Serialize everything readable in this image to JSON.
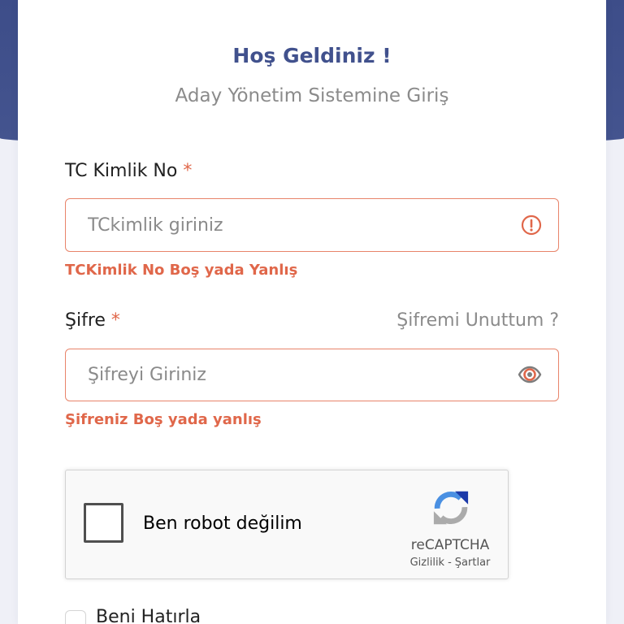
{
  "header": {
    "title": "Hoş Geldiniz !",
    "subtitle": "Aday Yönetim Sistemine Giriş"
  },
  "tc_field": {
    "label": "TC Kimlik No",
    "required_mark": "*",
    "placeholder": "TCkimlik giriniz",
    "value": "",
    "status_icon": "alert-circle-icon",
    "error": "TCKimlik No Boş yada Yanlış"
  },
  "password_field": {
    "label": "Şifre",
    "required_mark": "*",
    "forgot_link": "Şifremi Unuttum ?",
    "placeholder": "Şifreyi Giriniz",
    "value": "",
    "toggle_icon": "eye-icon",
    "error": "Şifreniz Boş yada yanlış"
  },
  "recaptcha": {
    "checkbox_label": "Ben robot değilim",
    "checked": false,
    "logo_icon": "recaptcha-logo-icon",
    "brand": "reCAPTCHA",
    "privacy_link": "Gizlilik",
    "separator": "-",
    "terms_link": "Şartlar"
  },
  "remember_me": {
    "label": "Beni Hatırla",
    "checked": false
  },
  "colors": {
    "brand": "#41518d",
    "error": "#e0674a",
    "page_background": "#eff0f7"
  }
}
